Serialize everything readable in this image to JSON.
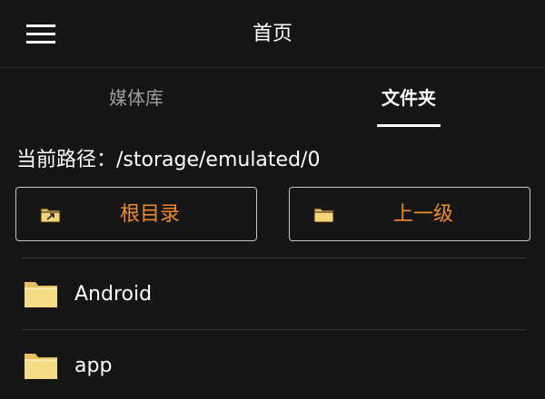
{
  "header": {
    "title": "首页"
  },
  "tabs": [
    {
      "label": "媒体库",
      "active": false
    },
    {
      "label": "文件夹",
      "active": true
    }
  ],
  "path": {
    "label": "当前路径：",
    "value": "/storage/emulated/0"
  },
  "nav": {
    "root_label": "根目录",
    "up_label": "上一级"
  },
  "files": [
    {
      "name": "Android",
      "icon": "folder-icon"
    },
    {
      "name": "app",
      "icon": "folder-icon"
    }
  ],
  "colors": {
    "background": "#151515",
    "accent": "#f08a24",
    "folder": "#f5d77a",
    "text": "#ffffff",
    "muted": "#9e9e9e"
  }
}
